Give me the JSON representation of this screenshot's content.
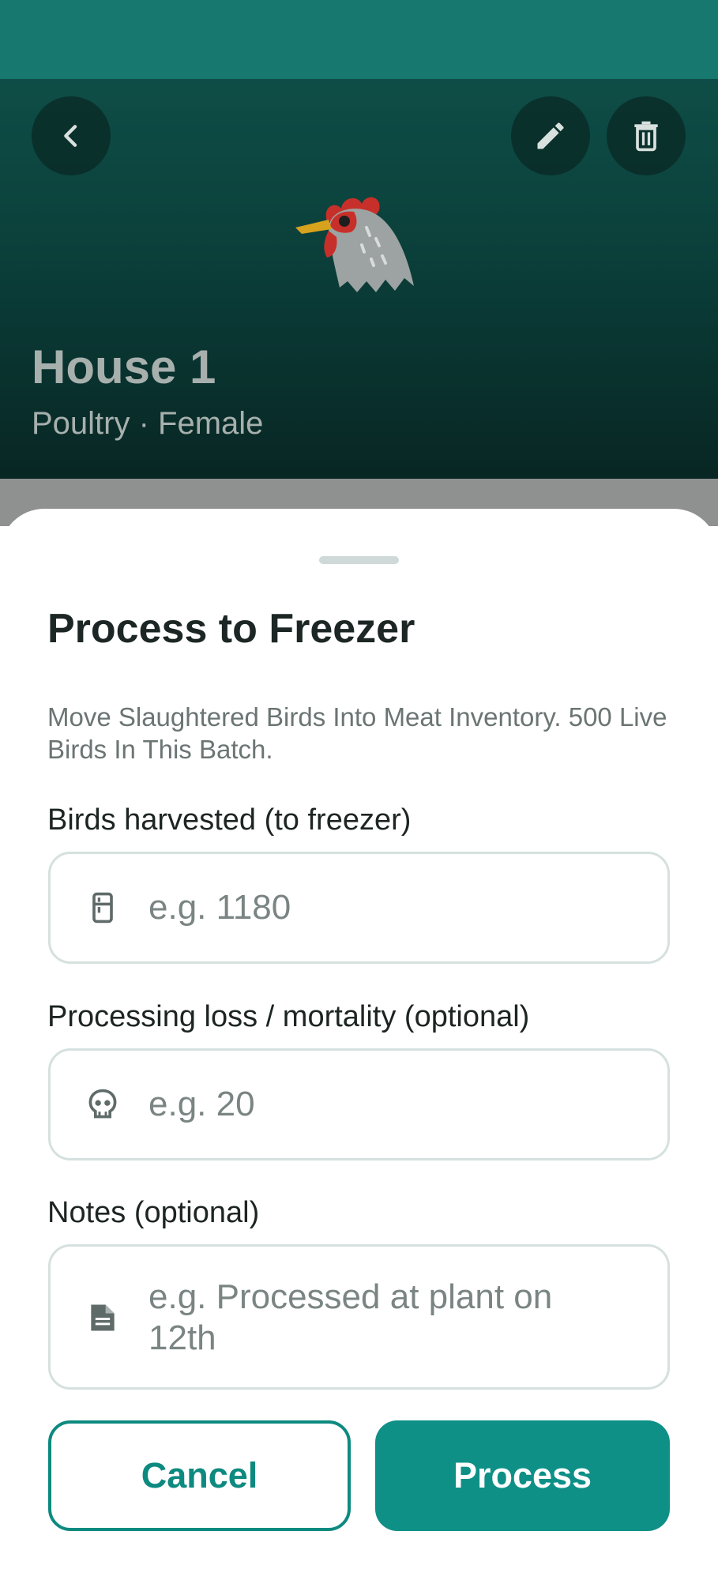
{
  "header": {
    "title": "House 1",
    "subtitle": "Poultry · Female",
    "icons": {
      "back": "chevron-left-icon",
      "edit": "pencil-icon",
      "delete": "trash-icon",
      "avatar": "rooster-emoji"
    }
  },
  "sheet": {
    "title": "Process to Freezer",
    "description": "Move Slaughtered Birds Into Meat Inventory. 500 Live Birds In This Batch.",
    "fields": [
      {
        "label": "Birds harvested (to freezer)",
        "placeholder": "e.g. 1180",
        "icon": "freezer-icon"
      },
      {
        "label": "Processing loss / mortality (optional)",
        "placeholder": "e.g. 20",
        "icon": "skull-icon"
      },
      {
        "label": "Notes (optional)",
        "placeholder": "e.g. Processed at plant on 12th",
        "icon": "note-icon"
      }
    ],
    "cancel_label": "Cancel",
    "process_label": "Process"
  },
  "colors": {
    "accent": "#0e9087",
    "status_bar": "#17786f",
    "hero_top": "#125f57",
    "hero_bottom": "#0a2f2c"
  }
}
